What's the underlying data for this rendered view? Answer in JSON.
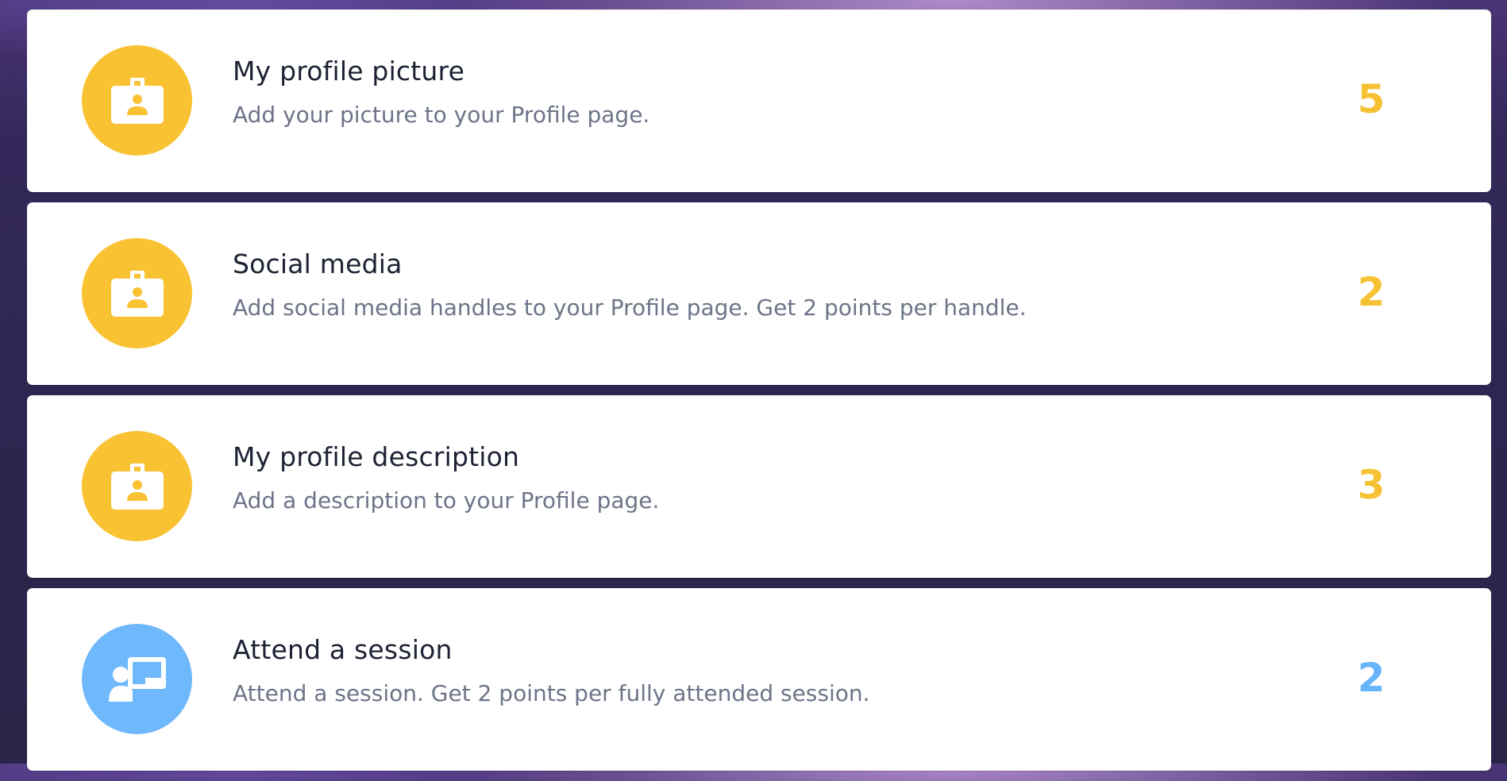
{
  "colors": {
    "badge_yellow": "#f9c233",
    "badge_blue": "#6fb8fb",
    "points_yellow": "#f6c234",
    "points_blue": "#67b4fb"
  },
  "activities": [
    {
      "icon": "id-badge-icon",
      "title": "My profile picture",
      "description": "Add your picture to your Profile page.",
      "points": "5"
    },
    {
      "icon": "id-badge-icon",
      "title": "Social media",
      "description": "Add social media handles to your Profile page. Get 2 points per handle.",
      "points": "2"
    },
    {
      "icon": "id-badge-icon",
      "title": "My profile description",
      "description": "Add a description to your Profile page.",
      "points": "3"
    },
    {
      "icon": "presenter-icon",
      "title": "Attend a session",
      "description": "Attend a session. Get 2 points per fully attended session.",
      "points": "2"
    }
  ]
}
